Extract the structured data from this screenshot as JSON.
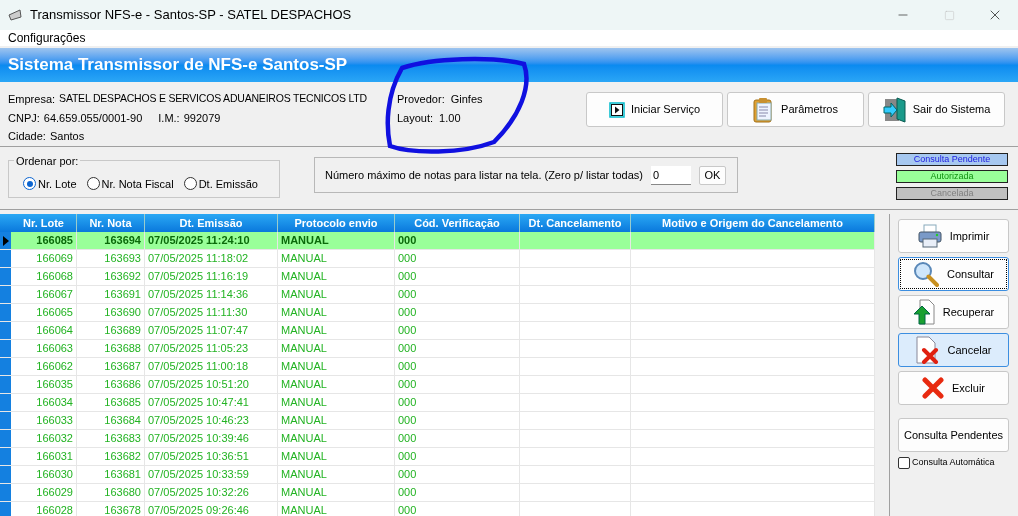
{
  "window": {
    "title": "Transmissor NFS-e - Santos-SP - SATEL DESPACHOS"
  },
  "menu": [
    "Configurações"
  ],
  "banner": {
    "title": "Sistema Transmissor de NFS-e Santos-SP"
  },
  "info": {
    "empresa_label": "Empresa:",
    "empresa": "SATEL DESPACHOS E SERVICOS ADUANEIROS TECNICOS LTD",
    "cnpj_label": "CNPJ:",
    "cnpj": "64.659.055/0001-90",
    "im_label": "I.M.:",
    "im": "992079",
    "cidade_label": "Cidade:",
    "cidade": "Santos",
    "provedor_label": "Provedor:",
    "provedor": "Ginfes",
    "layout_label": "Layout:",
    "layout": "1.00"
  },
  "top_buttons": [
    {
      "kind": "start",
      "label": "Iniciar Serviço"
    },
    {
      "kind": "params",
      "label": "Parâmetros"
    },
    {
      "kind": "exit",
      "label": "Sair do Sistema"
    }
  ],
  "sort": {
    "title": "Ordenar por:",
    "options": [
      {
        "label": "Nr. Lote",
        "selected": true
      },
      {
        "label": "Nr. Nota Fiscal",
        "selected": false
      },
      {
        "label": "Dt. Emissão",
        "selected": false
      }
    ]
  },
  "limit": {
    "label": "Número máximo de notas para listar na tela. (Zero p/ listar todas)",
    "value": "0",
    "button": "OK"
  },
  "legend": [
    {
      "label": "Consulta Pendente",
      "color": "#a6c8f0"
    },
    {
      "label": "Autorizada",
      "color": "#99ff99"
    },
    {
      "label": "Cancelada",
      "color": "#c0c0c0"
    }
  ],
  "table": {
    "columns": [
      "Nr. Lote",
      "Nr. Nota",
      "Dt. Emissão",
      "Protocolo envio",
      "Cód. Verificação",
      "Dt. Cancelamento",
      "Motivo e Origem do Cancelamento"
    ],
    "rows": [
      {
        "cells": [
          "166085",
          "163694",
          "07/05/2025 11:24:10",
          "MANUAL",
          "000"
        ],
        "selected": true
      },
      {
        "cells": [
          "166069",
          "163693",
          "07/05/2025 11:18:02",
          "MANUAL",
          "000"
        ],
        "selected": false
      },
      {
        "cells": [
          "166068",
          "163692",
          "07/05/2025 11:16:19",
          "MANUAL",
          "000"
        ],
        "selected": false
      },
      {
        "cells": [
          "166067",
          "163691",
          "07/05/2025 11:14:36",
          "MANUAL",
          "000"
        ],
        "selected": false
      },
      {
        "cells": [
          "166065",
          "163690",
          "07/05/2025 11:11:30",
          "MANUAL",
          "000"
        ],
        "selected": false
      },
      {
        "cells": [
          "166064",
          "163689",
          "07/05/2025 11:07:47",
          "MANUAL",
          "000"
        ],
        "selected": false
      },
      {
        "cells": [
          "166063",
          "163688",
          "07/05/2025 11:05:23",
          "MANUAL",
          "000"
        ],
        "selected": false
      },
      {
        "cells": [
          "166062",
          "163687",
          "07/05/2025 11:00:18",
          "MANUAL",
          "000"
        ],
        "selected": false
      },
      {
        "cells": [
          "166035",
          "163686",
          "07/05/2025 10:51:20",
          "MANUAL",
          "000"
        ],
        "selected": false
      },
      {
        "cells": [
          "166034",
          "163685",
          "07/05/2025 10:47:41",
          "MANUAL",
          "000"
        ],
        "selected": false
      },
      {
        "cells": [
          "166033",
          "163684",
          "07/05/2025 10:46:23",
          "MANUAL",
          "000"
        ],
        "selected": false
      },
      {
        "cells": [
          "166032",
          "163683",
          "07/05/2025 10:39:46",
          "MANUAL",
          "000"
        ],
        "selected": false
      },
      {
        "cells": [
          "166031",
          "163682",
          "07/05/2025 10:36:51",
          "MANUAL",
          "000"
        ],
        "selected": false
      },
      {
        "cells": [
          "166030",
          "163681",
          "07/05/2025 10:33:59",
          "MANUAL",
          "000"
        ],
        "selected": false
      },
      {
        "cells": [
          "166029",
          "163680",
          "07/05/2025 10:32:26",
          "MANUAL",
          "000"
        ],
        "selected": false
      },
      {
        "cells": [
          "166028",
          "163678",
          "07/05/2025 09:26:46",
          "MANUAL",
          "000"
        ],
        "selected": false
      }
    ]
  },
  "actions": [
    {
      "kind": "print",
      "label": "Imprimir",
      "focused": false,
      "hovered": false
    },
    {
      "kind": "search",
      "label": "Consultar",
      "focused": true,
      "hovered": false
    },
    {
      "kind": "recover",
      "label": "Recuperar",
      "focused": false,
      "hovered": false
    },
    {
      "kind": "cancel",
      "label": "Cancelar",
      "focused": false,
      "hovered": true
    },
    {
      "kind": "delete",
      "label": "Excluir",
      "focused": false,
      "hovered": false
    }
  ],
  "pending_button": "Consulta Pendentes",
  "auto_check": {
    "label": "Consulta Automática",
    "checked": false
  }
}
